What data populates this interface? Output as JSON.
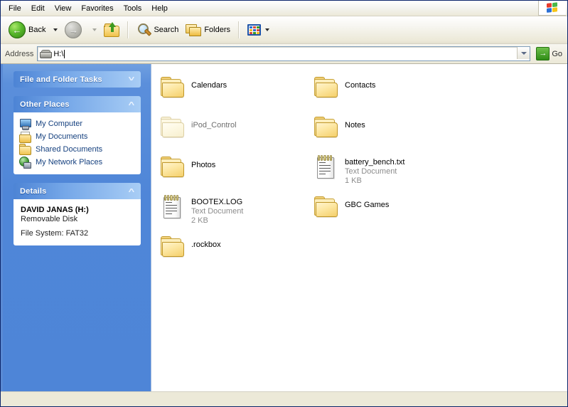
{
  "menu": {
    "items": [
      {
        "label": "File"
      },
      {
        "label": "Edit"
      },
      {
        "label": "View"
      },
      {
        "label": "Favorites"
      },
      {
        "label": "Tools"
      },
      {
        "label": "Help"
      }
    ],
    "logo_name": "windows-flag-logo"
  },
  "toolbar": {
    "back_label": "Back",
    "forward_label": "",
    "search_label": "Search",
    "folders_label": "Folders",
    "views_label": ""
  },
  "address": {
    "label": "Address",
    "value": "H:\\",
    "placeholder": "H:\\",
    "go_label": "Go",
    "go_glyph": "→"
  },
  "sidebar": {
    "panels": [
      {
        "title": "File and Folder Tasks",
        "collapsed": true,
        "chevron": "˅",
        "items": []
      },
      {
        "title": "Other Places",
        "collapsed": false,
        "chevron": "˄",
        "items": [
          {
            "label": "My Computer",
            "icon": "my-computer-icon"
          },
          {
            "label": "My Documents",
            "icon": "my-documents-icon"
          },
          {
            "label": "Shared Documents",
            "icon": "shared-documents-icon"
          },
          {
            "label": "My Network Places",
            "icon": "my-network-places-icon"
          }
        ]
      },
      {
        "title": "Details",
        "collapsed": false,
        "chevron": "˄",
        "details": {
          "name": "DAVID JANAS (H:)",
          "kind": "Removable Disk",
          "filesystem": "File System: FAT32"
        }
      }
    ]
  },
  "files": [
    {
      "name": "Calendars",
      "type": "",
      "size": "",
      "icon": "folder-icon",
      "faded": false
    },
    {
      "name": "Contacts",
      "type": "",
      "size": "",
      "icon": "folder-icon",
      "faded": false
    },
    {
      "name": "iPod_Control",
      "type": "",
      "size": "",
      "icon": "folder-icon",
      "faded": true
    },
    {
      "name": "Notes",
      "type": "",
      "size": "",
      "icon": "folder-icon",
      "faded": false
    },
    {
      "name": "Photos",
      "type": "",
      "size": "",
      "icon": "folder-icon",
      "faded": false
    },
    {
      "name": "battery_bench.txt",
      "type": "Text Document",
      "size": "1 KB",
      "icon": "text-document-icon",
      "faded": false
    },
    {
      "name": "BOOTEX.LOG",
      "type": "Text Document",
      "size": "2 KB",
      "icon": "text-document-icon",
      "faded": false
    },
    {
      "name": "GBC Games",
      "type": "",
      "size": "",
      "icon": "folder-icon",
      "faded": false
    },
    {
      "name": ".rockbox",
      "type": "",
      "size": "",
      "icon": "folder-icon",
      "faded": false
    }
  ],
  "statusbar": {
    "text": ""
  },
  "colors": {
    "sidebar_blue": "#4e85d7",
    "panel_header_blue": "#75a7e8",
    "link_blue": "#16417f",
    "accent_green": "#2f8c16"
  }
}
